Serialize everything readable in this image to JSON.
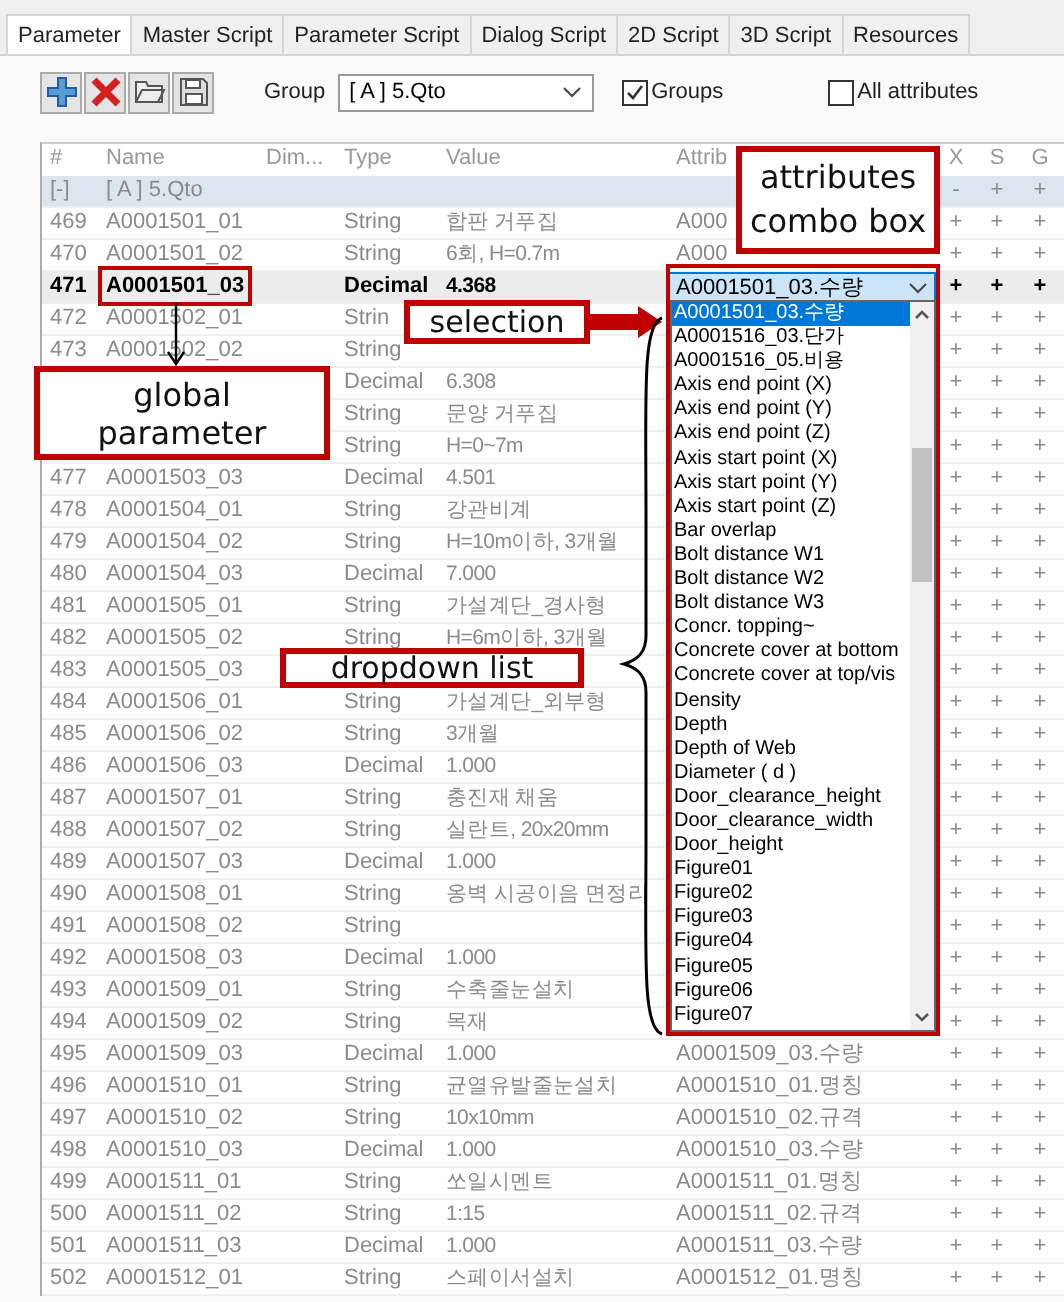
{
  "tabs": [
    {
      "label": "Parameter",
      "selected": true
    },
    {
      "label": "Master Script",
      "selected": false
    },
    {
      "label": "Parameter Script",
      "selected": false
    },
    {
      "label": "Dialog Script",
      "selected": false
    },
    {
      "label": "2D Script",
      "selected": false
    },
    {
      "label": "3D Script",
      "selected": false
    },
    {
      "label": "Resources",
      "selected": false
    }
  ],
  "toolbar": {
    "group_label": "Group",
    "group_value": "[ A ] 5.Qto",
    "checkboxes": [
      {
        "label": "Groups",
        "checked": true
      },
      {
        "label": "All attributes",
        "checked": false
      }
    ]
  },
  "table": {
    "columns": [
      "#",
      "Name",
      "Dim...",
      "Type",
      "Value",
      "Attrib",
      "X",
      "S",
      "G"
    ],
    "rows": [
      {
        "kind": "group",
        "num": "[-]",
        "name": "[ A ] 5.Qto",
        "x": "-",
        "s": "+",
        "g": "+",
        "selected": false
      },
      {
        "kind": "param",
        "num": "469",
        "name": "A0001501_01",
        "type": "String",
        "value": "합판 거푸집",
        "attribute": "A000",
        "x": "+",
        "s": "+",
        "g": "+",
        "selected": false
      },
      {
        "kind": "param",
        "num": "470",
        "name": "A0001501_02",
        "type": "String",
        "value": "6회, H=0.7m",
        "attribute": "A000",
        "x": "+",
        "s": "+",
        "g": "+",
        "selected": false
      },
      {
        "kind": "param",
        "num": "471",
        "name": "A0001501_03",
        "type": "Decimal",
        "value": "4.368",
        "attribute": "A0001501_03.수량",
        "x": "+",
        "s": "+",
        "g": "+",
        "selected": true
      },
      {
        "kind": "param",
        "num": "472",
        "name": "A0001502_01",
        "type": "Strin",
        "x": "+",
        "s": "+",
        "g": "+",
        "selected": false
      },
      {
        "kind": "param",
        "num": "473",
        "name": "A0001502_02",
        "type": "String",
        "x": "+",
        "s": "+",
        "g": "+",
        "selected": false
      },
      {
        "kind": "param",
        "type": "Decimal",
        "value": "6.308",
        "x": "+",
        "s": "+",
        "g": "+",
        "selected": false
      },
      {
        "kind": "param",
        "type": "String",
        "value": "문양 거푸집",
        "x": "+",
        "s": "+",
        "g": "+",
        "selected": false
      },
      {
        "kind": "param",
        "type": "String",
        "value": "H=0~7m",
        "x": "+",
        "s": "+",
        "g": "+",
        "selected": false
      },
      {
        "kind": "param",
        "num": "477",
        "name": "A0001503_03",
        "type": "Decimal",
        "value": "4.501",
        "x": "+",
        "s": "+",
        "g": "+",
        "selected": false
      },
      {
        "kind": "param",
        "num": "478",
        "name": "A0001504_01",
        "type": "String",
        "value": "강관비계",
        "x": "+",
        "s": "+",
        "g": "+",
        "selected": false
      },
      {
        "kind": "param",
        "num": "479",
        "name": "A0001504_02",
        "type": "String",
        "value": "H=10m이하, 3개월",
        "x": "+",
        "s": "+",
        "g": "+",
        "selected": false
      },
      {
        "kind": "param",
        "num": "480",
        "name": "A0001504_03",
        "type": "Decimal",
        "value": "7.000",
        "x": "+",
        "s": "+",
        "g": "+",
        "selected": false
      },
      {
        "kind": "param",
        "num": "481",
        "name": "A0001505_01",
        "type": "String",
        "value": "가설계단_경사형",
        "x": "+",
        "s": "+",
        "g": "+",
        "selected": false
      },
      {
        "kind": "param",
        "num": "482",
        "name": "A0001505_02",
        "type": "String",
        "value": "H=6m이하, 3개월",
        "x": "+",
        "s": "+",
        "g": "+",
        "selected": false
      },
      {
        "kind": "param",
        "num": "483",
        "name": "A0001505_03",
        "x": "+",
        "s": "+",
        "g": "+",
        "selected": false
      },
      {
        "kind": "param",
        "num": "484",
        "name": "A0001506_01",
        "type": "String",
        "value": "가설계단_외부형",
        "x": "+",
        "s": "+",
        "g": "+",
        "selected": false
      },
      {
        "kind": "param",
        "num": "485",
        "name": "A0001506_02",
        "type": "String",
        "value": "3개월",
        "x": "+",
        "s": "+",
        "g": "+",
        "selected": false
      },
      {
        "kind": "param",
        "num": "486",
        "name": "A0001506_03",
        "type": "Decimal",
        "value": "1.000",
        "x": "+",
        "s": "+",
        "g": "+",
        "selected": false
      },
      {
        "kind": "param",
        "num": "487",
        "name": "A0001507_01",
        "type": "String",
        "value": "충진재 채움",
        "x": "+",
        "s": "+",
        "g": "+",
        "selected": false
      },
      {
        "kind": "param",
        "num": "488",
        "name": "A0001507_02",
        "type": "String",
        "value": "실란트, 20x20mm",
        "x": "+",
        "s": "+",
        "g": "+",
        "selected": false
      },
      {
        "kind": "param",
        "num": "489",
        "name": "A0001507_03",
        "type": "Decimal",
        "value": "1.000",
        "x": "+",
        "s": "+",
        "g": "+",
        "selected": false
      },
      {
        "kind": "param",
        "num": "490",
        "name": "A0001508_01",
        "type": "String",
        "value": "옹벽 시공이음 면정리",
        "x": "+",
        "s": "+",
        "g": "+",
        "selected": false
      },
      {
        "kind": "param",
        "num": "491",
        "name": "A0001508_02",
        "type": "String",
        "x": "+",
        "s": "+",
        "g": "+",
        "selected": false
      },
      {
        "kind": "param",
        "num": "492",
        "name": "A0001508_03",
        "type": "Decimal",
        "value": "1.000",
        "x": "+",
        "s": "+",
        "g": "+",
        "selected": false
      },
      {
        "kind": "param",
        "num": "493",
        "name": "A0001509_01",
        "type": "String",
        "value": "수축줄눈설치",
        "x": "+",
        "s": "+",
        "g": "+",
        "selected": false
      },
      {
        "kind": "param",
        "num": "494",
        "name": "A0001509_02",
        "type": "String",
        "value": "목재",
        "x": "+",
        "s": "+",
        "g": "+",
        "selected": false
      },
      {
        "kind": "param",
        "num": "495",
        "name": "A0001509_03",
        "type": "Decimal",
        "value": "1.000",
        "attribute": "A0001509_03.수량",
        "x": "+",
        "s": "+",
        "g": "+",
        "selected": false
      },
      {
        "kind": "param",
        "num": "496",
        "name": "A0001510_01",
        "type": "String",
        "value": "균열유발줄눈설치",
        "attribute": "A0001510_01.명칭",
        "x": "+",
        "s": "+",
        "g": "+",
        "selected": false
      },
      {
        "kind": "param",
        "num": "497",
        "name": "A0001510_02",
        "type": "String",
        "value": "10x10mm",
        "attribute": "A0001510_02.규격",
        "x": "+",
        "s": "+",
        "g": "+",
        "selected": false
      },
      {
        "kind": "param",
        "num": "498",
        "name": "A0001510_03",
        "type": "Decimal",
        "value": "1.000",
        "attribute": "A0001510_03.수량",
        "x": "+",
        "s": "+",
        "g": "+",
        "selected": false
      },
      {
        "kind": "param",
        "num": "499",
        "name": "A0001511_01",
        "type": "String",
        "value": "쏘일시멘트",
        "attribute": "A0001511_01.명칭",
        "x": "+",
        "s": "+",
        "g": "+",
        "selected": false
      },
      {
        "kind": "param",
        "num": "500",
        "name": "A0001511_02",
        "type": "String",
        "value": "1:15",
        "attribute": "A0001511_02.규격",
        "x": "+",
        "s": "+",
        "g": "+",
        "selected": false
      },
      {
        "kind": "param",
        "num": "501",
        "name": "A0001511_03",
        "type": "Decimal",
        "value": "1.000",
        "attribute": "A0001511_03.수량",
        "x": "+",
        "s": "+",
        "g": "+",
        "selected": false
      },
      {
        "kind": "param",
        "num": "502",
        "name": "A0001512_01",
        "type": "String",
        "value": "스페이서설치",
        "attribute": "A0001512_01.명칭",
        "x": "+",
        "s": "+",
        "g": "+",
        "selected": false
      }
    ]
  },
  "dropdown": {
    "items": [
      {
        "label": "A0001501_03.수량",
        "selected": true
      },
      {
        "label": "A0001516_03.단가",
        "selected": false
      },
      {
        "label": "A0001516_05.비용",
        "selected": false
      },
      {
        "label": "Axis end point (X)",
        "selected": false
      },
      {
        "label": "Axis end point (Y)",
        "selected": false
      },
      {
        "label": "Axis end point (Z)",
        "selected": false
      },
      {
        "label": "Axis start point (X)",
        "selected": false
      },
      {
        "label": "Axis start point (Y)",
        "selected": false
      },
      {
        "label": "Axis start point (Z)",
        "selected": false
      },
      {
        "label": "Bar overlap",
        "selected": false
      },
      {
        "label": "Bolt distance W1",
        "selected": false
      },
      {
        "label": "Bolt distance W2",
        "selected": false
      },
      {
        "label": "Bolt distance W3",
        "selected": false
      },
      {
        "label": "Concr. topping~",
        "selected": false
      },
      {
        "label": "Concrete cover at bottom",
        "selected": false
      },
      {
        "label": "Concrete cover at top/vis",
        "selected": false
      },
      {
        "label": "Density",
        "selected": false
      },
      {
        "label": "Depth",
        "selected": false
      },
      {
        "label": "Depth of Web",
        "selected": false
      },
      {
        "label": "Diameter ( d )",
        "selected": false
      },
      {
        "label": "Door_clearance_height",
        "selected": false
      },
      {
        "label": "Door_clearance_width",
        "selected": false
      },
      {
        "label": "Door_height",
        "selected": false
      },
      {
        "label": "Figure01",
        "selected": false
      },
      {
        "label": "Figure02",
        "selected": false
      },
      {
        "label": "Figure03",
        "selected": false
      },
      {
        "label": "Figure04",
        "selected": false
      },
      {
        "label": "Figure05",
        "selected": false
      },
      {
        "label": "Figure06",
        "selected": false
      },
      {
        "label": "Figure07",
        "selected": false
      }
    ]
  },
  "annotations": [
    "attributes combo box",
    "selection",
    "global parameter",
    "dropdown list"
  ]
}
